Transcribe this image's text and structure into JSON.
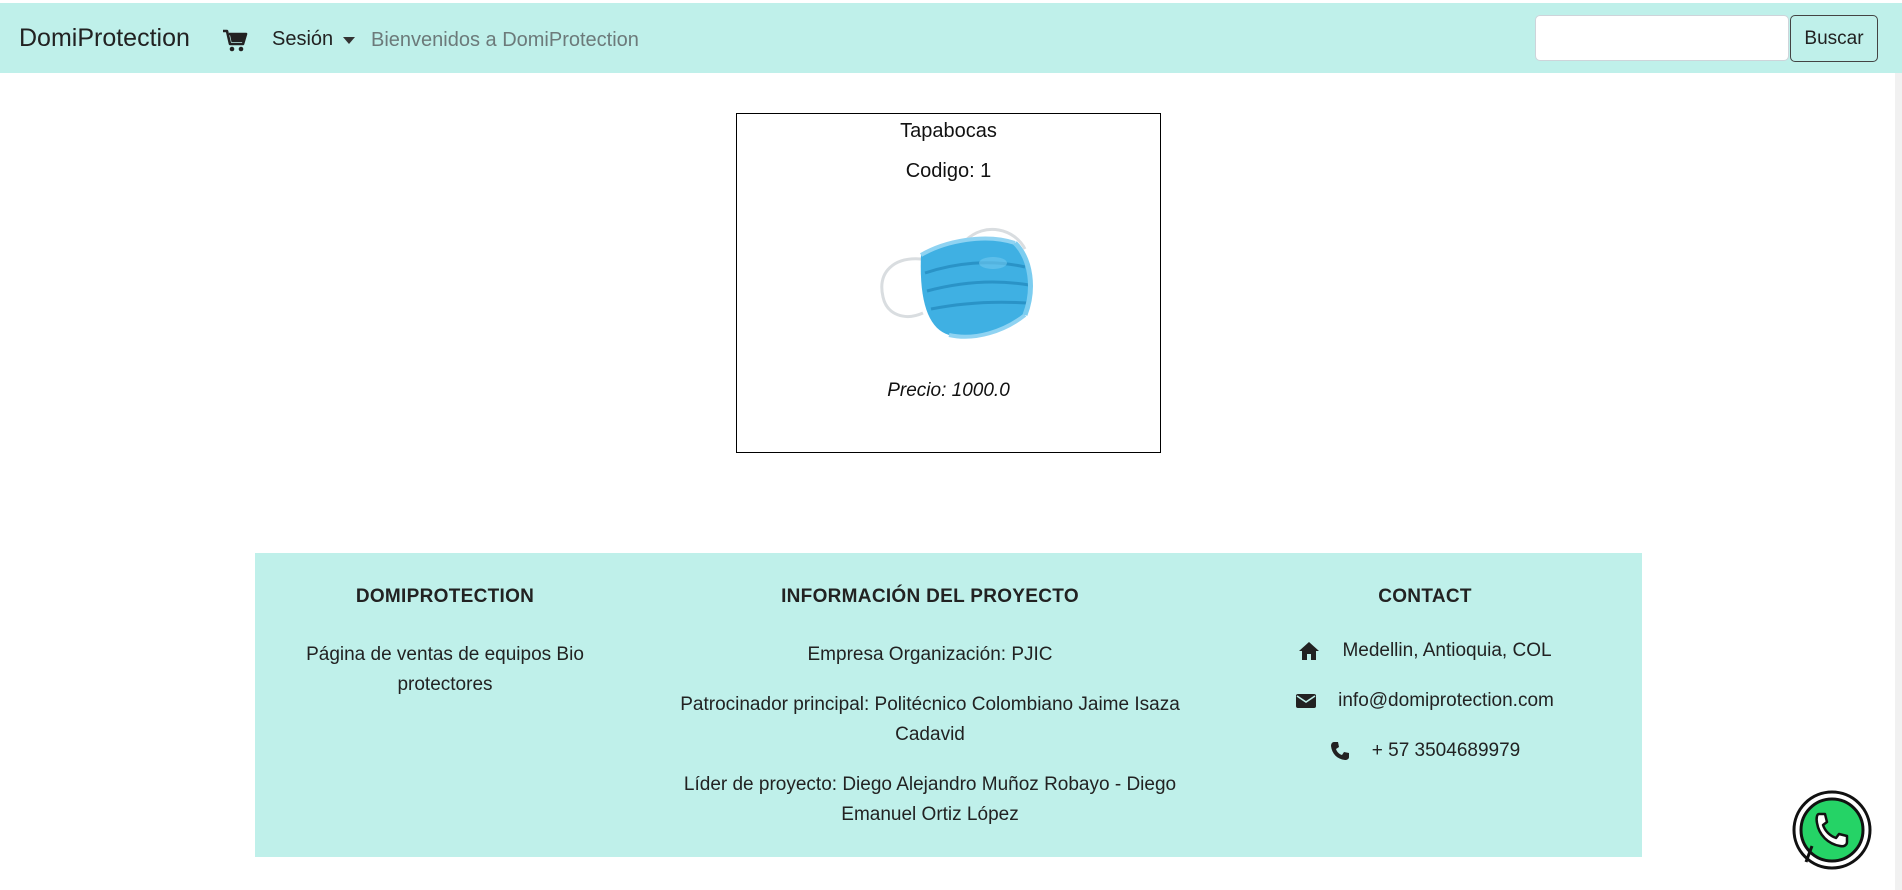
{
  "navbar": {
    "brand": "DomiProtection",
    "cart_icon": "shopping-cart-icon",
    "session_label": "Sesión",
    "welcome_text": "Bienvenidos a DomiProtection",
    "search": {
      "value": "",
      "placeholder": ""
    },
    "search_button": "Buscar"
  },
  "product": {
    "name": "Tapabocas",
    "code": "Codigo: 1",
    "image_icon": "face-mask-image",
    "price": "Precio: 1000.0"
  },
  "footer": {
    "about": {
      "heading": "DOMIPROTECTION",
      "text_line1": "Página de ventas de equipos Bio",
      "text_line2": "protectores"
    },
    "project": {
      "heading": "INFORMACIÓN DEL PROYECTO",
      "company": "Empresa Organización: PJIC",
      "sponsor_line1": "Patrocinador principal: Politécnico Colombiano Jaime Isaza",
      "sponsor_line2": "Cadavid",
      "leader_line1": "Líder de proyecto: Diego Alejandro Muñoz Robayo - Diego",
      "leader_line2": "Emanuel Ortiz López"
    },
    "contact": {
      "heading": "CONTACT",
      "address": "Medellin, Antioquia, COL",
      "email": "info@domiprotection.com",
      "phone": "+ 57 3504689979"
    }
  },
  "colors": {
    "accent": "#bff0ea",
    "whatsapp": "#25d366"
  }
}
